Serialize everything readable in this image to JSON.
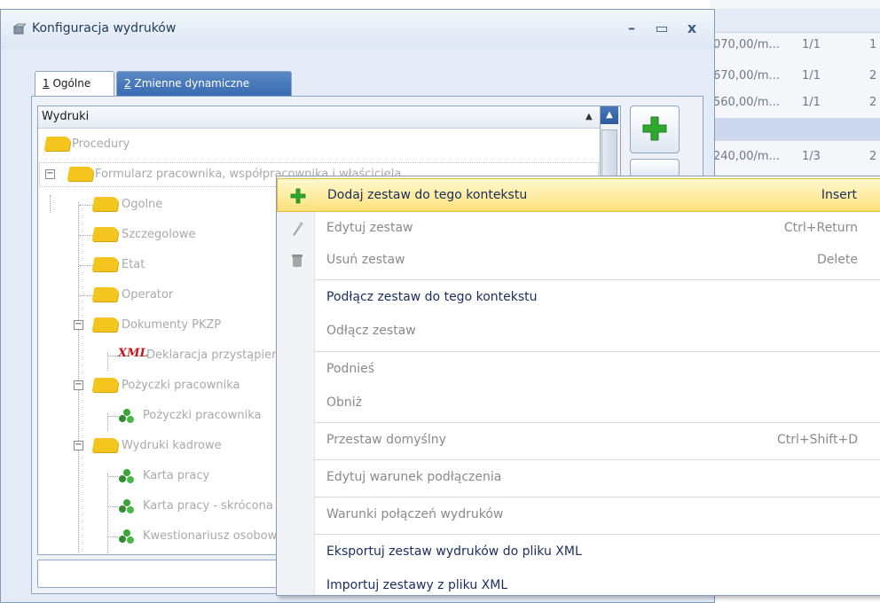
{
  "window": {
    "title": "Konfiguracja wydruków",
    "minimize": "–",
    "maximize": "▭",
    "close": "x"
  },
  "tabs": [
    {
      "number": "1",
      "label": "Ogólne"
    },
    {
      "number": "2",
      "label": "Zmienne dynamiczne"
    }
  ],
  "tree": {
    "header": "Wydruki",
    "items": [
      {
        "label": "Procedury",
        "icon": "folder-icon"
      },
      {
        "label": "Formularz pracownika, współpracownika i właściciela",
        "icon": "folder-icon"
      },
      {
        "label": "Ogolne",
        "icon": "folder-icon"
      },
      {
        "label": "Szczegolowe",
        "icon": "folder-icon"
      },
      {
        "label": "Etat",
        "icon": "folder-icon"
      },
      {
        "label": "Operator",
        "icon": "folder-icon"
      },
      {
        "label": "Dokumenty PKZP",
        "icon": "folder-icon"
      },
      {
        "label": "Deklaracja przystąpienia",
        "icon": "xml-icon",
        "icon_text": "XML"
      },
      {
        "label": "Pożyczki pracownika",
        "icon": "folder-icon"
      },
      {
        "label": "Pożyczki pracownika",
        "icon": "printout-icon"
      },
      {
        "label": "Wydruki kadrowe",
        "icon": "folder-icon"
      },
      {
        "label": "Karta pracy",
        "icon": "printout-icon"
      },
      {
        "label": "Karta pracy - skrócona",
        "icon": "printout-icon"
      },
      {
        "label": "Kwestionariusz osobowy",
        "icon": "printout-icon"
      }
    ]
  },
  "background_grid": {
    "rows": [
      {
        "c1": "070,00/m...",
        "c2": "1/1",
        "c3": "1"
      },
      {
        "c1": "670,00/m...",
        "c2": "1/1",
        "c3": "2"
      },
      {
        "c1": "560,00/m...",
        "c2": "1/1",
        "c3": "2"
      },
      {
        "c1": "",
        "c2": "",
        "c3": ""
      },
      {
        "c1": "240,00/m...",
        "c2": "1/3",
        "c3": "2"
      }
    ]
  },
  "context_menu": {
    "items": [
      {
        "label": "Dodaj zestaw do tego kontekstu",
        "shortcut": "Insert",
        "enabled": true,
        "icon": "add-icon"
      },
      {
        "label": "Edytuj zestaw",
        "shortcut": "Ctrl+Return",
        "enabled": false,
        "icon": "edit-icon"
      },
      {
        "label": "Usuń zestaw",
        "shortcut": "Delete",
        "enabled": false,
        "icon": "delete-icon"
      },
      {
        "label": "Podłącz zestaw do tego kontekstu",
        "shortcut": "",
        "enabled": true
      },
      {
        "label": "Odłącz zestaw",
        "shortcut": "",
        "enabled": false
      },
      {
        "label": "Podnieś",
        "shortcut": "",
        "enabled": false
      },
      {
        "label": "Obniż",
        "shortcut": "",
        "enabled": false
      },
      {
        "label": "Przestaw domyślny",
        "shortcut": "Ctrl+Shift+D",
        "enabled": false
      },
      {
        "label": "Edytuj warunek podłączenia",
        "shortcut": "",
        "enabled": false
      },
      {
        "label": "Warunki połączeń wydruków",
        "shortcut": "",
        "enabled": false
      },
      {
        "label": "Eksportuj zestaw wydruków do pliku XML",
        "shortcut": "",
        "enabled": true
      },
      {
        "label": "Importuj zestawy z pliku XML",
        "shortcut": "",
        "enabled": true
      }
    ]
  },
  "colors": {
    "accent": "#3a6bb1",
    "highlight": "#fde27a",
    "menu_text": "#1b2c5e",
    "disabled_text": "#8a8a8a",
    "folder": "#f5c51f",
    "add_green": "#2fa82f"
  }
}
